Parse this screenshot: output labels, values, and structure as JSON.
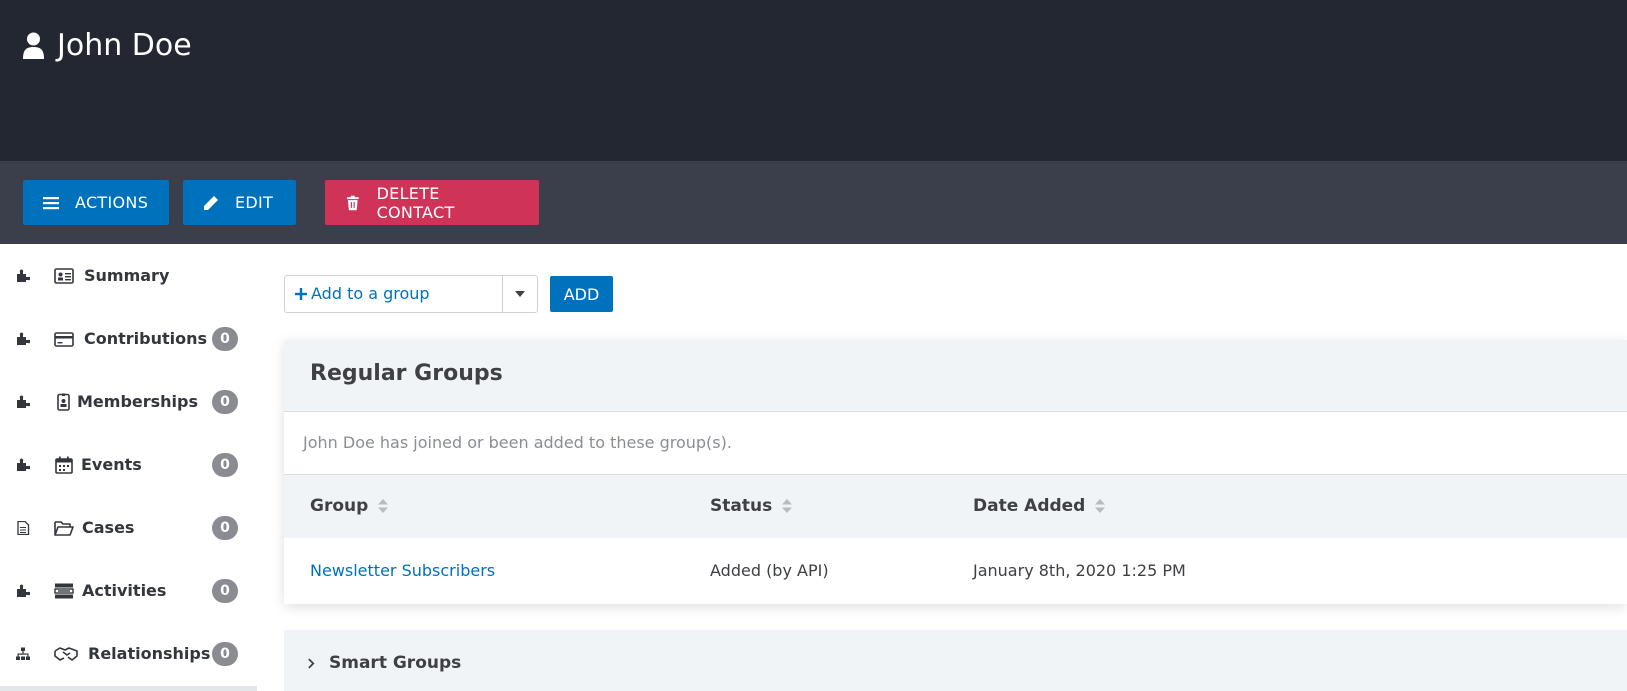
{
  "header": {
    "title": "John Doe",
    "icon": "user-icon"
  },
  "toolbar": {
    "actions_label": "ACTIONS",
    "edit_label": "EDIT",
    "delete_label": "DELETE CONTACT"
  },
  "sidebar": {
    "items": [
      {
        "label": "Summary",
        "icon": "id-card-icon",
        "badge": ""
      },
      {
        "label": "Contributions",
        "icon": "credit-card-icon",
        "badge": "0"
      },
      {
        "label": "Memberships",
        "icon": "id-badge-icon",
        "badge": "0"
      },
      {
        "label": "Events",
        "icon": "calendar-icon",
        "badge": "0"
      },
      {
        "label": "Cases",
        "icon": "folder-open-icon",
        "badge": "0"
      },
      {
        "label": "Activities",
        "icon": "tasks-icon",
        "badge": "0"
      },
      {
        "label": "Relationships",
        "icon": "handshake-icon",
        "badge": "0"
      }
    ]
  },
  "group_picker": {
    "placeholder": "Add to a group",
    "add_label": "ADD"
  },
  "regular_groups": {
    "title": "Regular Groups",
    "description": "John Doe has joined or been added to these group(s).",
    "columns": [
      "Group",
      "Status",
      "Date Added"
    ],
    "rows": [
      {
        "group": "Newsletter Subscribers",
        "status": "Added (by API)",
        "date_added": "January 8th, 2020 1:25 PM"
      }
    ]
  },
  "smart_groups": {
    "title": "Smart Groups"
  },
  "colors": {
    "header_bg": "#222732",
    "toolbar_bg": "#3a3f4b",
    "primary": "#0071bd",
    "danger": "#cf3458",
    "badge": "#8a8c92"
  }
}
